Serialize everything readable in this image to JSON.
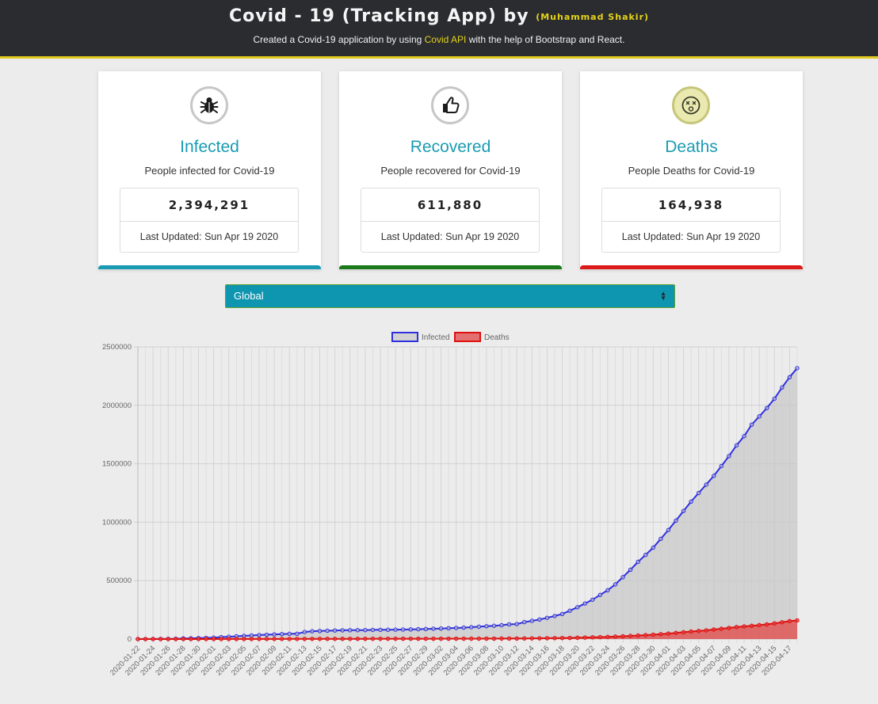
{
  "header": {
    "title": "Covid - 19 (Tracking App) by",
    "author": "(Muhammad Shakir)",
    "subtitle_pre": "Created a Covid-19 application by using",
    "subtitle_link": "Covid API",
    "subtitle_post": "with the help of Bootstrap and React."
  },
  "cards": [
    {
      "icon": "bug-icon",
      "title": "Infected",
      "desc": "People infected for Covid-19",
      "count": "2,394,291",
      "updated": "Last Updated: Sun Apr 19 2020",
      "color": "#1a9bb3"
    },
    {
      "icon": "thumbs-up-icon",
      "title": "Recovered",
      "desc": "People recovered for Covid-19",
      "count": "611,880",
      "updated": "Last Updated: Sun Apr 19 2020",
      "color": "#1a7a1a"
    },
    {
      "icon": "dizzy-face-icon",
      "title": "Deaths",
      "desc": "People Deaths for Covid-19",
      "count": "164,938",
      "updated": "Last Updated: Sun Apr 19 2020",
      "color": "#dd1a1a"
    }
  ],
  "country_select": {
    "selected": "Global"
  },
  "chart_data": {
    "type": "area",
    "ylim": [
      0,
      2500000
    ],
    "yticks": [
      0,
      500000,
      1000000,
      1500000,
      2000000,
      2500000
    ],
    "x_start": "2020-01-22",
    "x_end": "2020-04-18",
    "x_tick_labels_every_other_day": true,
    "series": [
      {
        "name": "Infected",
        "color": "#2f2fe0",
        "fill": "rgba(200,200,200,0.7)",
        "values": [
          555,
          654,
          941,
          1434,
          2118,
          2927,
          5578,
          6166,
          8234,
          9927,
          12038,
          16787,
          19881,
          23892,
          27636,
          30818,
          34392,
          37121,
          40151,
          42763,
          44803,
          45222,
          60370,
          66887,
          69032,
          71226,
          73260,
          75138,
          75641,
          76199,
          76843,
          78599,
          78985,
          79570,
          80415,
          81397,
          82756,
          84124,
          86013,
          88371,
          90309,
          92844,
          95124,
          97886,
          101800,
          105836,
          109835,
          113582,
          118582,
          125865,
          128343,
          145193,
          156097,
          167449,
          181531,
          197146,
          214910,
          242708,
          272166,
          304524,
          336953,
          378235,
          418045,
          467653,
          529591,
          593291,
          660706,
          720140,
          782389,
          857487,
          932605,
          1013466,
          1095917,
          1176060,
          1249754,
          1321481,
          1396476,
          1480202,
          1565278,
          1657526,
          1735650,
          1834721,
          1904838,
          1976191,
          2056054,
          2152437,
          2240190,
          2317758
        ]
      },
      {
        "name": "Deaths",
        "color": "#e01010",
        "fill": "rgba(225,70,70,0.75)",
        "values": [
          17,
          18,
          26,
          42,
          56,
          82,
          131,
          133,
          171,
          213,
          259,
          362,
          426,
          492,
          564,
          634,
          719,
          806,
          906,
          1013,
          1113,
          1118,
          1371,
          1523,
          1666,
          1770,
          1868,
          2007,
          2122,
          2247,
          2251,
          2458,
          2469,
          2629,
          2708,
          2770,
          2814,
          2872,
          2941,
          2996,
          3085,
          3160,
          3254,
          3348,
          3460,
          3558,
          3803,
          3996,
          4262,
          4615,
          4720,
          5404,
          5819,
          6440,
          7126,
          7905,
          8733,
          9867,
          11299,
          12973,
          14651,
          16505,
          18625,
          21181,
          23970,
          27198,
          30652,
          33925,
          37582,
          42107,
          46809,
          52983,
          58787,
          64606,
          69374,
          74565,
          81865,
          88338,
          95455,
          102525,
          108503,
          114090,
          119482,
          125984,
          134176,
          143800,
          153822,
          159510
        ]
      }
    ]
  }
}
